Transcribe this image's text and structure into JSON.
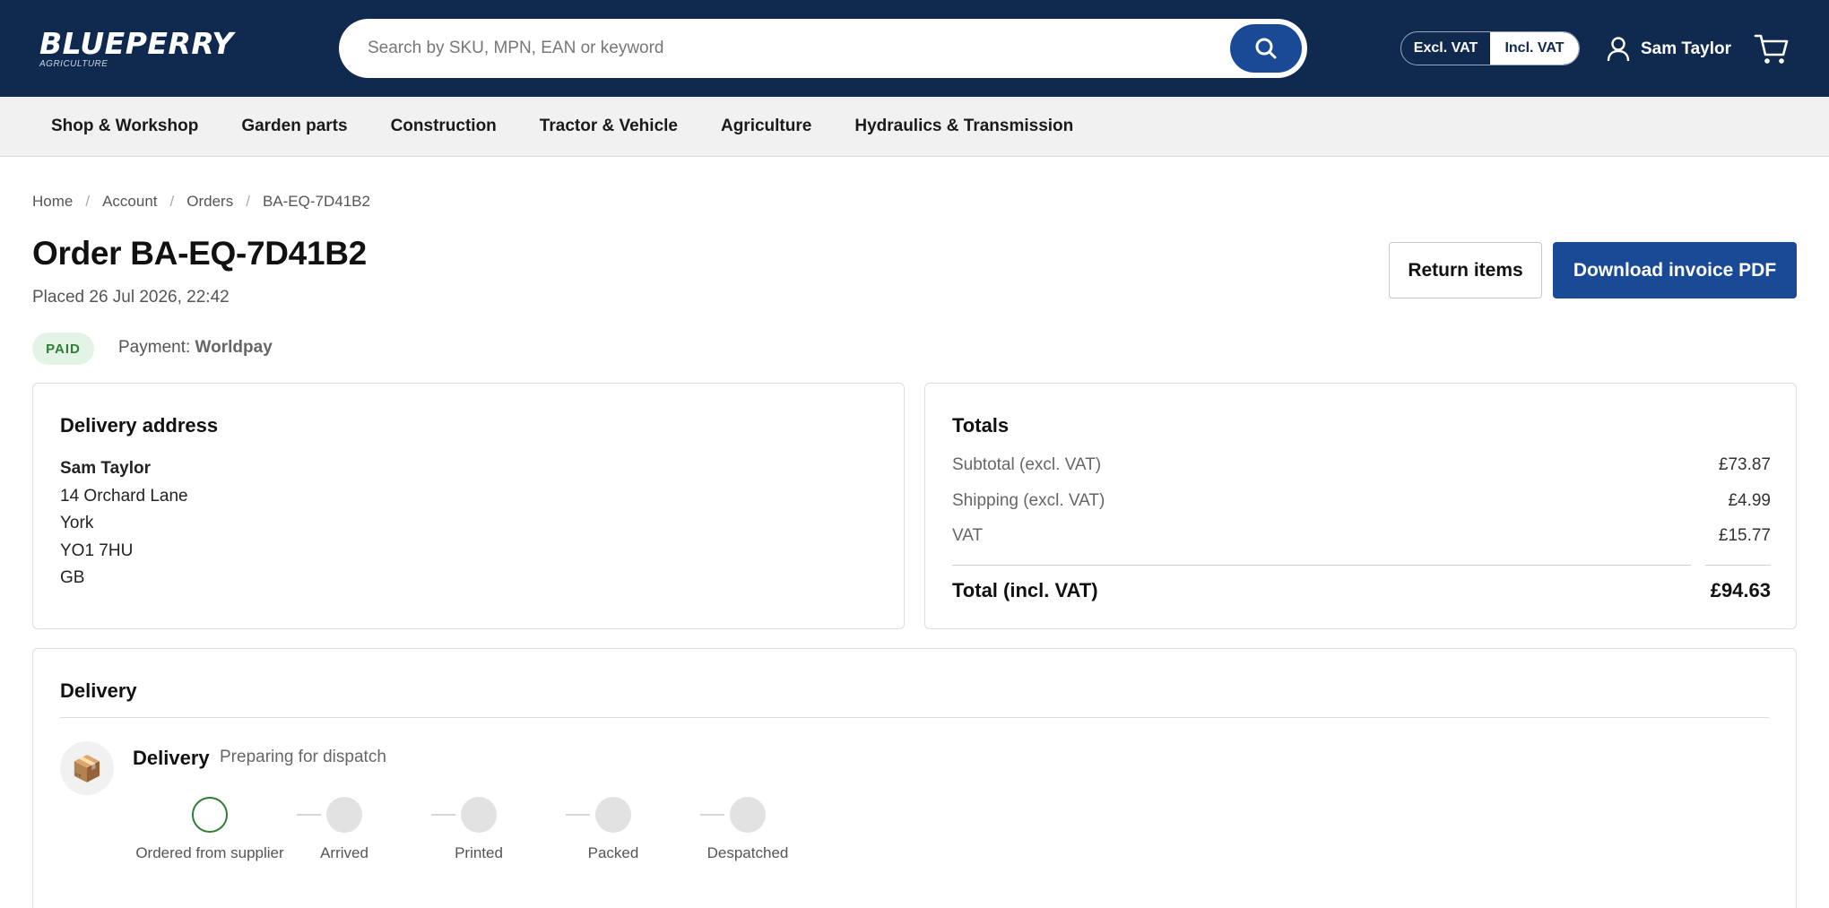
{
  "brand": {
    "name": "BLUEPERRY",
    "tagline": "AGRICULTURE"
  },
  "search": {
    "placeholder": "Search by SKU, MPN, EAN or keyword",
    "icon": "search-icon"
  },
  "vat_toggle": {
    "options": [
      "Excl. VAT",
      "Incl. VAT"
    ],
    "selected": "Incl. VAT"
  },
  "user": {
    "name": "Sam Taylor",
    "icon": "user-icon"
  },
  "cart": {
    "icon": "cart-icon"
  },
  "categories": [
    "Shop & Workshop",
    "Garden parts",
    "Construction",
    "Tractor & Vehicle",
    "Agriculture",
    "Hydraulics & Transmission"
  ],
  "breadcrumb": [
    "Home",
    "Account",
    "Orders",
    "BA-EQ-7D41B2"
  ],
  "order": {
    "title": "Order BA-EQ-7D41B2",
    "placed": "Placed 26 Jul 2026, 22:42",
    "status_badge": "PAID",
    "payment_label": "Payment:",
    "payment_method": "Worldpay"
  },
  "actions": {
    "return_label": "Return items",
    "invoice_label": "Download invoice PDF"
  },
  "delivery_address": {
    "title": "Delivery address",
    "name": "Sam Taylor",
    "line1": "14 Orchard Lane",
    "city": "York",
    "postcode": "YO1 7HU",
    "country": "GB"
  },
  "totals": {
    "title": "Totals",
    "rows": [
      {
        "label": "Subtotal (excl. VAT)",
        "value": "£73.87"
      },
      {
        "label": "Shipping (excl. VAT)",
        "value": "£4.99"
      },
      {
        "label": "VAT",
        "value": "£15.77"
      }
    ],
    "total_label": "Total (incl. VAT)",
    "total_value": "£94.63"
  },
  "delivery": {
    "title": "Delivery",
    "label": "Delivery",
    "status": "Preparing for dispatch",
    "icon": "package-icon",
    "steps": [
      "Ordered from supplier",
      "Arrived",
      "Printed",
      "Packed",
      "Despatched"
    ],
    "current_step": 0
  },
  "colors": {
    "header": "#10294f",
    "accent": "#1a4a96",
    "paid_bg": "#e3f3e6",
    "paid_text": "#2e7d32"
  }
}
